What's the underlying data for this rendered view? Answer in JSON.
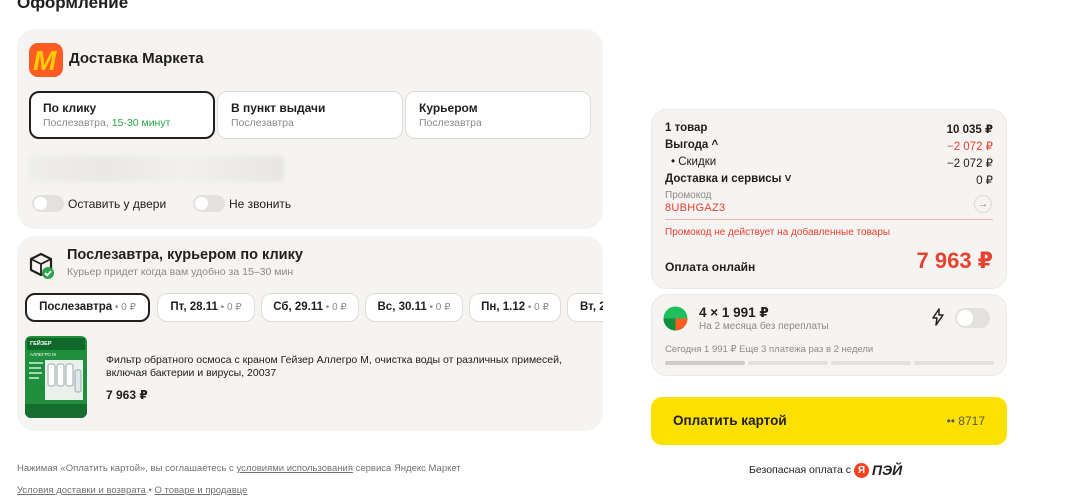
{
  "page_title": "Оформление",
  "delivery": {
    "title": "Доставка Маркета",
    "options": [
      {
        "label": "По клику",
        "sub": "Послезавтра, ",
        "sub_accent": "15-30 минут"
      },
      {
        "label": "В пункт выдачи",
        "sub": "Послезавтра"
      },
      {
        "label": "Курьером",
        "sub": "Послезавтра"
      }
    ],
    "toggles": [
      {
        "label": "Оставить у двери",
        "on": false
      },
      {
        "label": "Не звонить",
        "on": false
      }
    ]
  },
  "shipment": {
    "title": "Послезавтра, курьером по клику",
    "subtitle": "Курьер придет когда вам удобно за 15–30 мин",
    "days": [
      {
        "label": "Послезавтра",
        "price": " • 0 ₽"
      },
      {
        "label": "Пт, 28.11",
        "price": " • 0 ₽"
      },
      {
        "label": "Сб, 29.11",
        "price": " • 0 ₽"
      },
      {
        "label": "Вс, 30.11",
        "price": " • 0 ₽"
      },
      {
        "label": "Пн, 1.12",
        "price": " • 0 ₽"
      },
      {
        "label": "Вт, 2",
        "price": ""
      }
    ],
    "product": {
      "brand": "ГЕЙЗЕР",
      "model": "АЛЛЕГРО М",
      "name": "Фильтр обратного осмоса с краном Гейзер Аллегро М, очистка воды от различных примесей, включая бактерии и вирусы, 20037",
      "price": "7 963 ₽"
    }
  },
  "legal": {
    "terms_prefix": "Нажимая «Оплатить картой», вы соглашаетесь с ",
    "terms_link": "условиями использования",
    "terms_suffix": " сервиса Яндекс Маркет",
    "link_delivery": "Условия доставки и возврата",
    "separator": " • ",
    "link_seller": "О товаре и продавце"
  },
  "summary": {
    "items_label": "1 товар",
    "items_value": "10 035 ₽",
    "benefit_label": "Выгода ^",
    "benefit_value": "−2 072 ₽",
    "discounts_label": "• Скидки",
    "discounts_value": "−2 072 ₽",
    "delivery_label": "Доставка и сервисы ˅",
    "delivery_value": "0 ₽",
    "promo_label": "Промокод",
    "promo_code": "8UBHGAZ3",
    "promo_error": "Промокод не действует на добавленные товары",
    "pay_online_label": "Оплата онлайн",
    "total": "7 963 ₽"
  },
  "split": {
    "title": "4 × 1 991 ₽",
    "subtitle": "На 2 месяца без переплаты",
    "today": "Сегодня 1 991 ₽  Еще 3 платежа раз в 2 недели",
    "enabled": false
  },
  "pay_button": {
    "label": "Оплатить картой",
    "card": "•• 8717"
  },
  "secure": {
    "text": "Безопасная оплата с",
    "ya": "Я",
    "brand": "ПЭЙ"
  },
  "colors": {
    "accent_yellow": "#fce000",
    "error_red": "#e8412e",
    "brand_orange": "#ff5b23",
    "success_green": "#2aa34a"
  }
}
